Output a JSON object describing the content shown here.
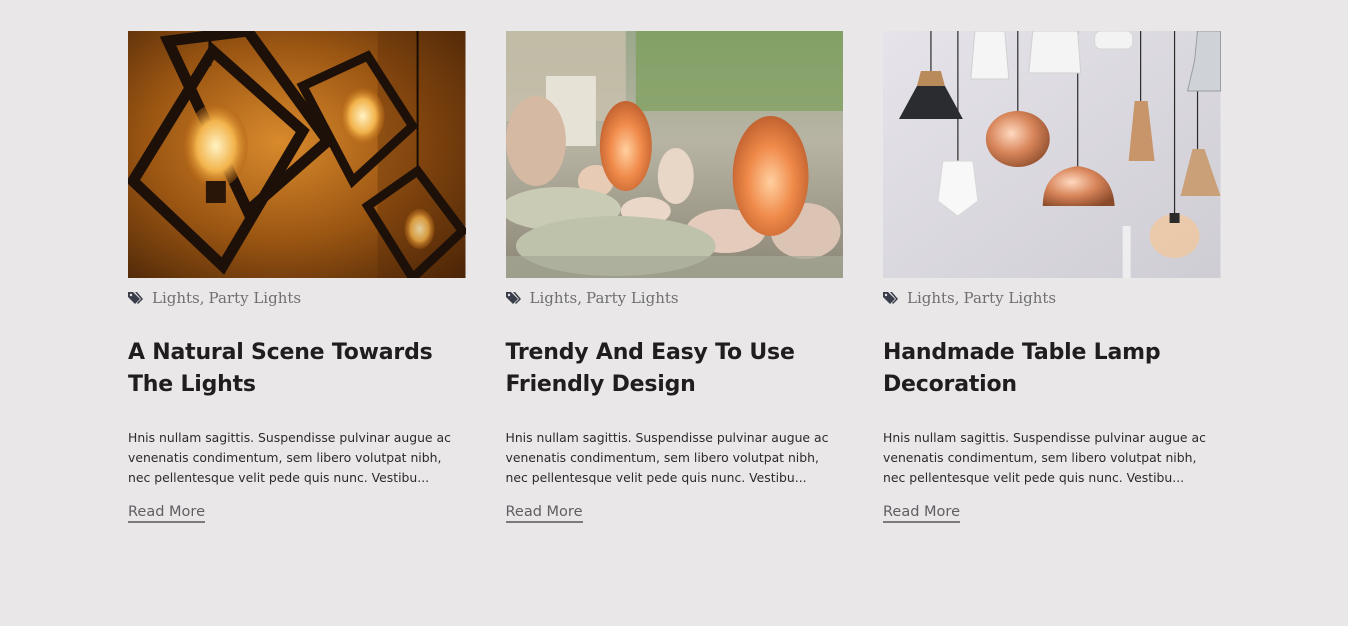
{
  "posts": [
    {
      "image": "hanging-geometric-edison-bulbs-photo",
      "categories": [
        "Lights",
        "Party Lights"
      ],
      "title": "A Natural Scene Towards The Lights",
      "excerpt": "Hnis nullam sagittis. Suspendisse pulvinar augue ac venenatis condimentum, sem libero volutpat nibh, nec pellentesque velit pede quis nunc. Vestibu...",
      "read_more": "Read More"
    },
    {
      "image": "salt-lamps-display-photo",
      "categories": [
        "Lights",
        "Party Lights"
      ],
      "title": "Trendy And Easy To Use Friendly Design",
      "excerpt": "Hnis nullam sagittis. Suspendisse pulvinar augue ac venenatis condimentum, sem libero volutpat nibh, nec pellentesque velit pede quis nunc. Vestibu...",
      "read_more": "Read More"
    },
    {
      "image": "pendant-lamps-wall-photo",
      "categories": [
        "Lights",
        "Party Lights"
      ],
      "title": "Handmade Table Lamp Decoration",
      "excerpt": "Hnis nullam sagittis. Suspendisse pulvinar augue ac venenatis condimentum, sem libero volutpat nibh, nec pellentesque velit pede quis nunc. Vestibu...",
      "read_more": "Read More"
    }
  ],
  "icons": {
    "category": "tags-icon"
  },
  "colors": {
    "background": "#e9e7e8",
    "title": "#1f1d1e",
    "meta": "#6f6f72",
    "link": "#5f5e62"
  }
}
